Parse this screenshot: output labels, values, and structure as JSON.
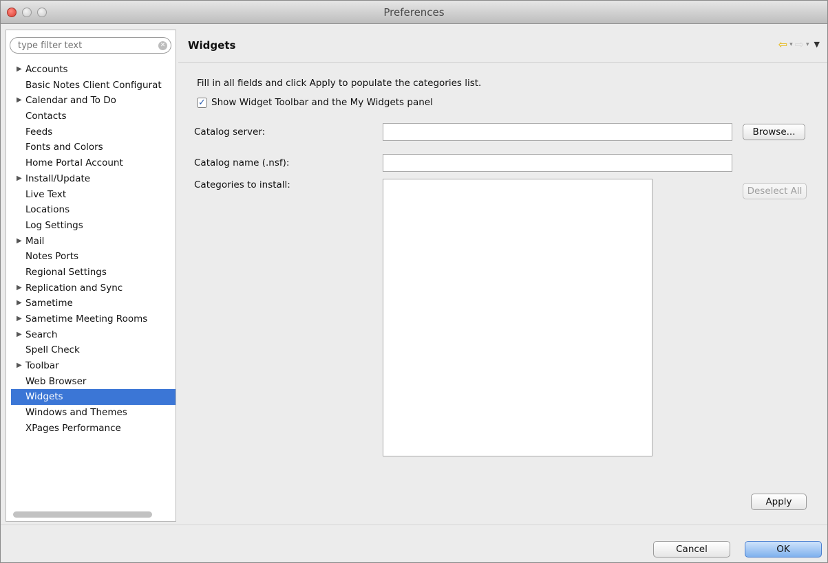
{
  "window": {
    "title": "Preferences"
  },
  "sidebar": {
    "filter_placeholder": "type filter text",
    "items": [
      {
        "label": "Accounts",
        "expandable": true
      },
      {
        "label": "Basic Notes Client Configurat",
        "expandable": false
      },
      {
        "label": "Calendar and To Do",
        "expandable": true
      },
      {
        "label": "Contacts",
        "expandable": false
      },
      {
        "label": "Feeds",
        "expandable": false
      },
      {
        "label": "Fonts and Colors",
        "expandable": false
      },
      {
        "label": "Home Portal Account",
        "expandable": false
      },
      {
        "label": "Install/Update",
        "expandable": true
      },
      {
        "label": "Live Text",
        "expandable": false
      },
      {
        "label": "Locations",
        "expandable": false
      },
      {
        "label": "Log Settings",
        "expandable": false
      },
      {
        "label": "Mail",
        "expandable": true
      },
      {
        "label": "Notes Ports",
        "expandable": false
      },
      {
        "label": "Regional Settings",
        "expandable": false
      },
      {
        "label": "Replication and Sync",
        "expandable": true
      },
      {
        "label": "Sametime",
        "expandable": true
      },
      {
        "label": "Sametime Meeting Rooms",
        "expandable": true
      },
      {
        "label": "Search",
        "expandable": true
      },
      {
        "label": "Spell Check",
        "expandable": false
      },
      {
        "label": "Toolbar",
        "expandable": true
      },
      {
        "label": "Web Browser",
        "expandable": false
      },
      {
        "label": "Widgets",
        "expandable": false,
        "selected": true
      },
      {
        "label": "Windows and Themes",
        "expandable": false
      },
      {
        "label": "XPages Performance",
        "expandable": false
      }
    ]
  },
  "panel": {
    "title": "Widgets",
    "intro": "Fill in all fields and click Apply to populate the categories list.",
    "show_toolbar_label": "Show Widget Toolbar and the My Widgets panel",
    "show_toolbar_checked": true,
    "catalog_server_label": "Catalog server:",
    "catalog_server_value": "",
    "browse_label": "Browse...",
    "catalog_name_label": "Catalog name (.nsf):",
    "catalog_name_value": "",
    "categories_label": "Categories to install:",
    "categories": [],
    "deselect_all_label": "Deselect All",
    "apply_label": "Apply"
  },
  "footer": {
    "cancel_label": "Cancel",
    "ok_label": "OK"
  },
  "colors": {
    "selection": "#3b76d6",
    "nav_back": "#e6b300"
  }
}
